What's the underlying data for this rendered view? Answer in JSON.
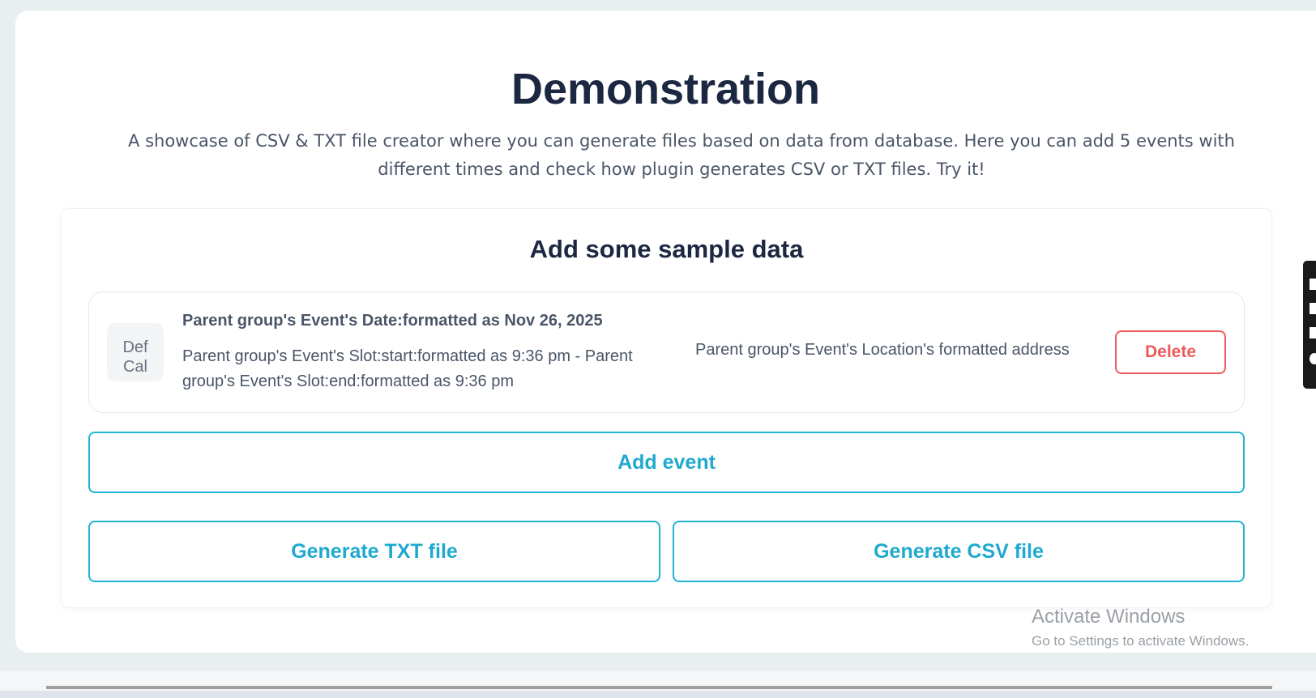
{
  "header": {
    "title": "Demonstration",
    "subtitle": "A showcase of CSV & TXT file creator where you can generate files based on data from database. Here you can add 5 events with different times and check how plugin generates CSV or TXT files. Try it!"
  },
  "card": {
    "heading": "Add some sample data",
    "event": {
      "thumb_line1": "Def",
      "thumb_line2": "Cal",
      "date": "Parent group's Event's Date:formatted as Nov 26, 2025",
      "time": "Parent group's Event's Slot:start:formatted as 9:36 pm - Parent group's Event's Slot:end:formatted as 9:36 pm",
      "location": "Parent group's Event's Location's formatted address",
      "delete_label": "Delete"
    },
    "add_event_label": "Add event",
    "generate_txt_label": "Generate TXT file",
    "generate_csv_label": "Generate CSV file"
  },
  "watermark": {
    "line1": "Activate Windows",
    "line2": "Go to Settings to activate Windows."
  },
  "colors": {
    "accent": "#22b3d3",
    "danger": "#ef5a5a",
    "heading": "#1c2741"
  },
  "toolbar": {
    "icons": [
      "camera-icon",
      "square-icon",
      "copy-icon",
      "gear-icon"
    ]
  }
}
